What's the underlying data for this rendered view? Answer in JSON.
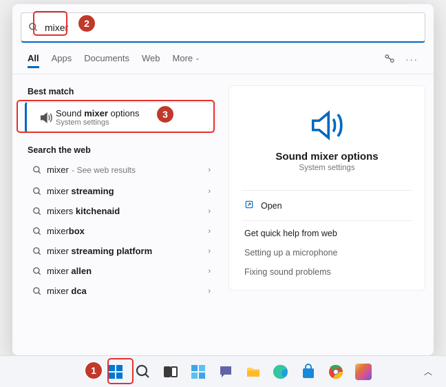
{
  "search": {
    "value": "mixer"
  },
  "tabs": {
    "all": "All",
    "apps": "Apps",
    "documents": "Documents",
    "web": "Web",
    "more": "More"
  },
  "sections": {
    "best_match": "Best match",
    "search_web": "Search the web"
  },
  "best": {
    "pre": "Sound ",
    "bold": "mixer",
    "post": " options",
    "sub": "System settings"
  },
  "web_results": [
    {
      "term": "mixer",
      "hint": "See web results"
    },
    {
      "pre": "mixer ",
      "bold": "streaming",
      "post": ""
    },
    {
      "pre": "mixers ",
      "bold": "kitchenaid",
      "post": ""
    },
    {
      "pre": "mixer",
      "bold": "box",
      "post": ""
    },
    {
      "pre": "mixer ",
      "bold": "streaming platform",
      "post": ""
    },
    {
      "pre": "mixer ",
      "bold": "allen",
      "post": ""
    },
    {
      "pre": "mixer ",
      "bold": "dca",
      "post": ""
    }
  ],
  "preview": {
    "title": "Sound mixer options",
    "sub": "System settings",
    "open": "Open",
    "quick_help": "Get quick help from web",
    "links": [
      "Setting up a microphone",
      "Fixing sound problems"
    ]
  },
  "callouts": {
    "c1": "1",
    "c2": "2",
    "c3": "3"
  }
}
